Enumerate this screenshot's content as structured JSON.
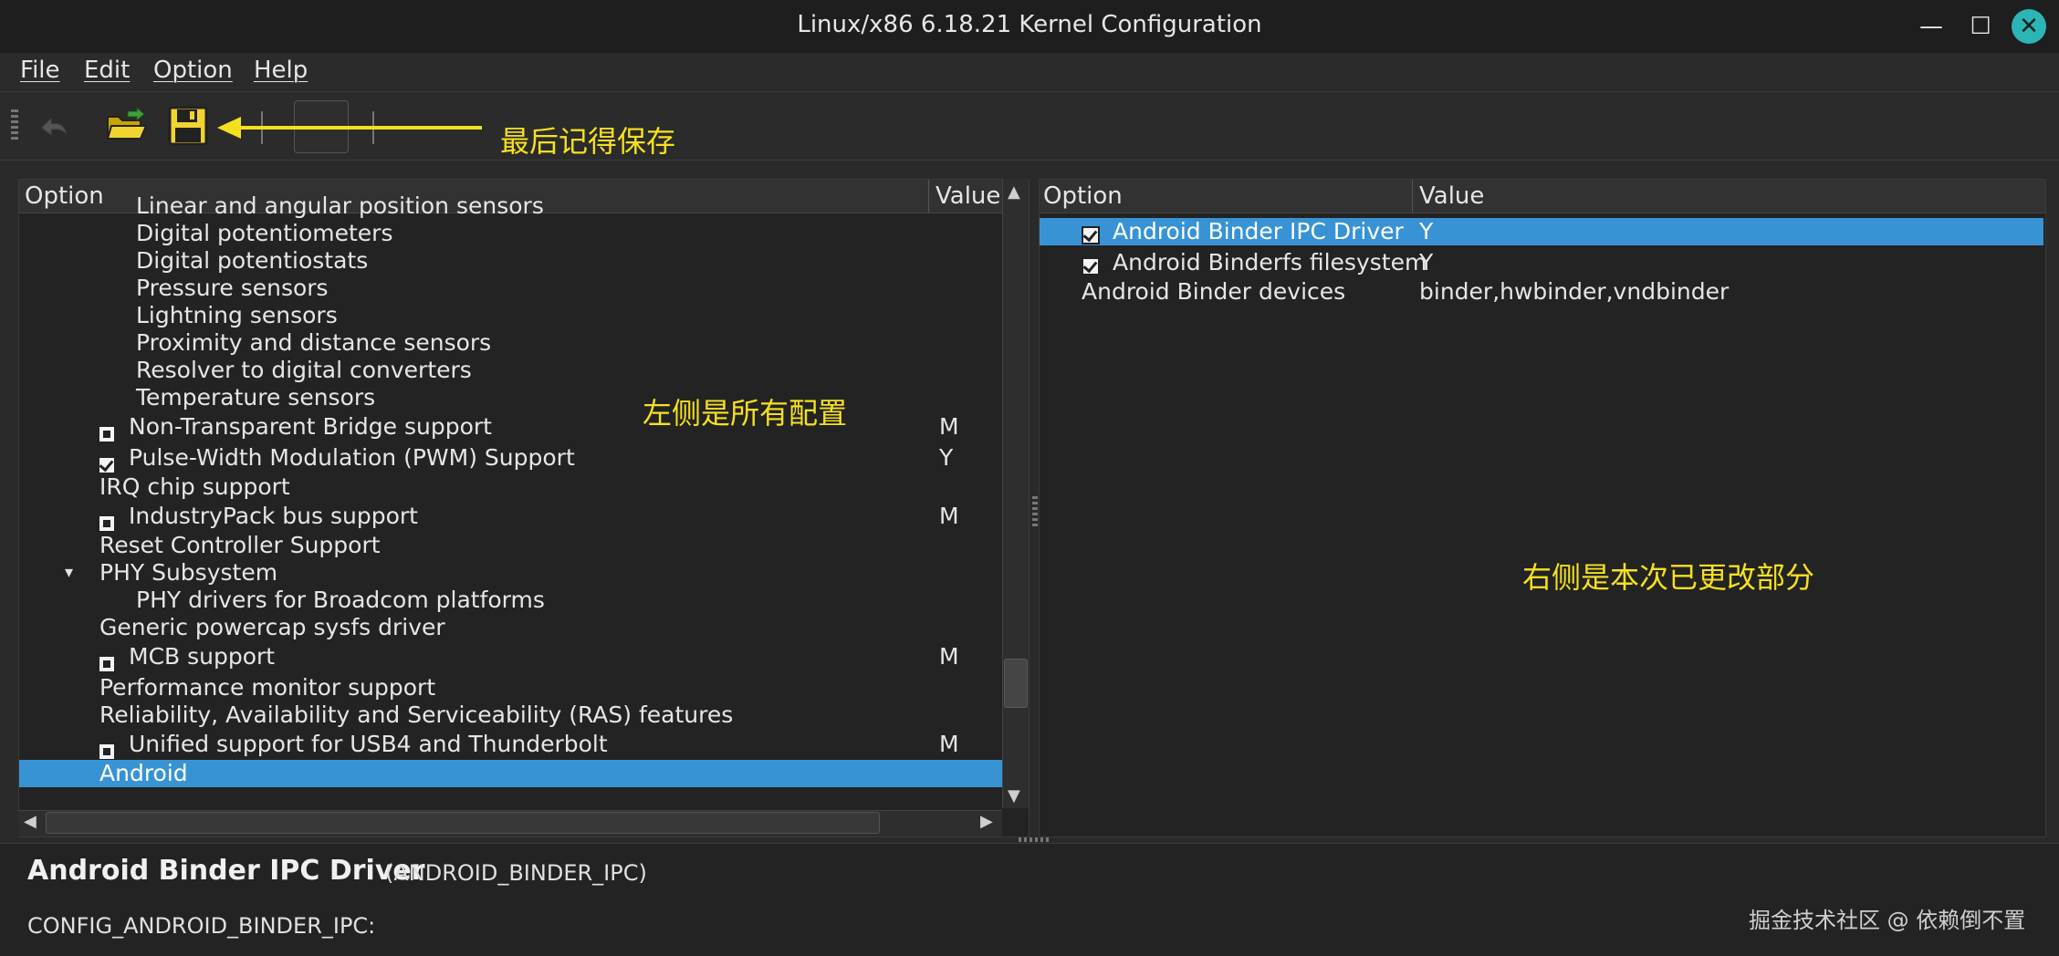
{
  "window": {
    "title": "Linux/x86 6.18.21 Kernel Configuration",
    "min_icon": "minimize-icon",
    "max_icon": "maximize-icon",
    "close_icon": "close-icon",
    "close_glyph": "✕",
    "min_glyph": "—",
    "max_glyph": "☐"
  },
  "menu": [
    "File",
    "Edit",
    "Option",
    "Help"
  ],
  "toolbar": {
    "icons": [
      "back-icon",
      "open-folder-icon",
      "save-icon"
    ],
    "annotation": "最后记得保存"
  },
  "left_tree": {
    "headers": {
      "option": "Option",
      "value": "Value"
    },
    "rows": [
      {
        "label": "Linear and angular position sensors",
        "indent": 2,
        "check": "",
        "value": ""
      },
      {
        "label": "Digital potentiometers",
        "indent": 2,
        "check": "",
        "value": ""
      },
      {
        "label": "Digital potentiostats",
        "indent": 2,
        "check": "",
        "value": ""
      },
      {
        "label": "Pressure sensors",
        "indent": 2,
        "check": "",
        "value": ""
      },
      {
        "label": "Lightning sensors",
        "indent": 2,
        "check": "",
        "value": ""
      },
      {
        "label": "Proximity and distance sensors",
        "indent": 2,
        "check": "",
        "value": ""
      },
      {
        "label": "Resolver to digital converters",
        "indent": 2,
        "check": "",
        "value": ""
      },
      {
        "label": "Temperature sensors",
        "indent": 2,
        "check": "",
        "value": ""
      },
      {
        "label": "Non-Transparent Bridge support",
        "indent": 1,
        "check": "mod",
        "value": "M"
      },
      {
        "label": "Pulse-Width Modulation (PWM) Support",
        "indent": 1,
        "check": "on",
        "value": "Y"
      },
      {
        "label": "IRQ chip support",
        "indent": 1,
        "check": "",
        "value": ""
      },
      {
        "label": "IndustryPack bus support",
        "indent": 1,
        "check": "mod",
        "value": "M"
      },
      {
        "label": "Reset Controller Support",
        "indent": 1,
        "check": "",
        "value": ""
      },
      {
        "label": "PHY Subsystem",
        "indent": 1,
        "check": "",
        "value": "",
        "expander": "▾"
      },
      {
        "label": "PHY drivers for Broadcom platforms",
        "indent": 2,
        "check": "",
        "value": ""
      },
      {
        "label": "Generic powercap sysfs driver",
        "indent": 1,
        "check": "",
        "value": ""
      },
      {
        "label": "MCB support",
        "indent": 1,
        "check": "mod",
        "value": "M"
      },
      {
        "label": "Performance monitor support",
        "indent": 1,
        "check": "",
        "value": ""
      },
      {
        "label": "Reliability, Availability and Serviceability (RAS) features",
        "indent": 1,
        "check": "",
        "value": ""
      },
      {
        "label": "Unified support for USB4 and Thunderbolt",
        "indent": 1,
        "check": "mod",
        "value": "M"
      },
      {
        "label": "Android",
        "indent": 1,
        "check": "",
        "value": "",
        "selected": true
      }
    ],
    "annotation": "左侧是所有配置"
  },
  "right_list": {
    "headers": {
      "option": "Option",
      "value": "Value"
    },
    "rows": [
      {
        "label": "Android Binder IPC Driver",
        "check": "on",
        "value": "Y",
        "selected": true
      },
      {
        "label": "Android Binderfs filesystem",
        "check": "on",
        "value": "Y"
      },
      {
        "label": "Android Binder devices",
        "check": "",
        "value": "binder,hwbinder,vndbinder"
      }
    ],
    "annotation": "右侧是本次已更改部分"
  },
  "help": {
    "title": "Android Binder IPC Driver",
    "symbol": "(ANDROID_BINDER_IPC)",
    "config": "CONFIG_ANDROID_BINDER_IPC:",
    "watermark": "掘金技术社区 @ 依赖倒不置"
  }
}
